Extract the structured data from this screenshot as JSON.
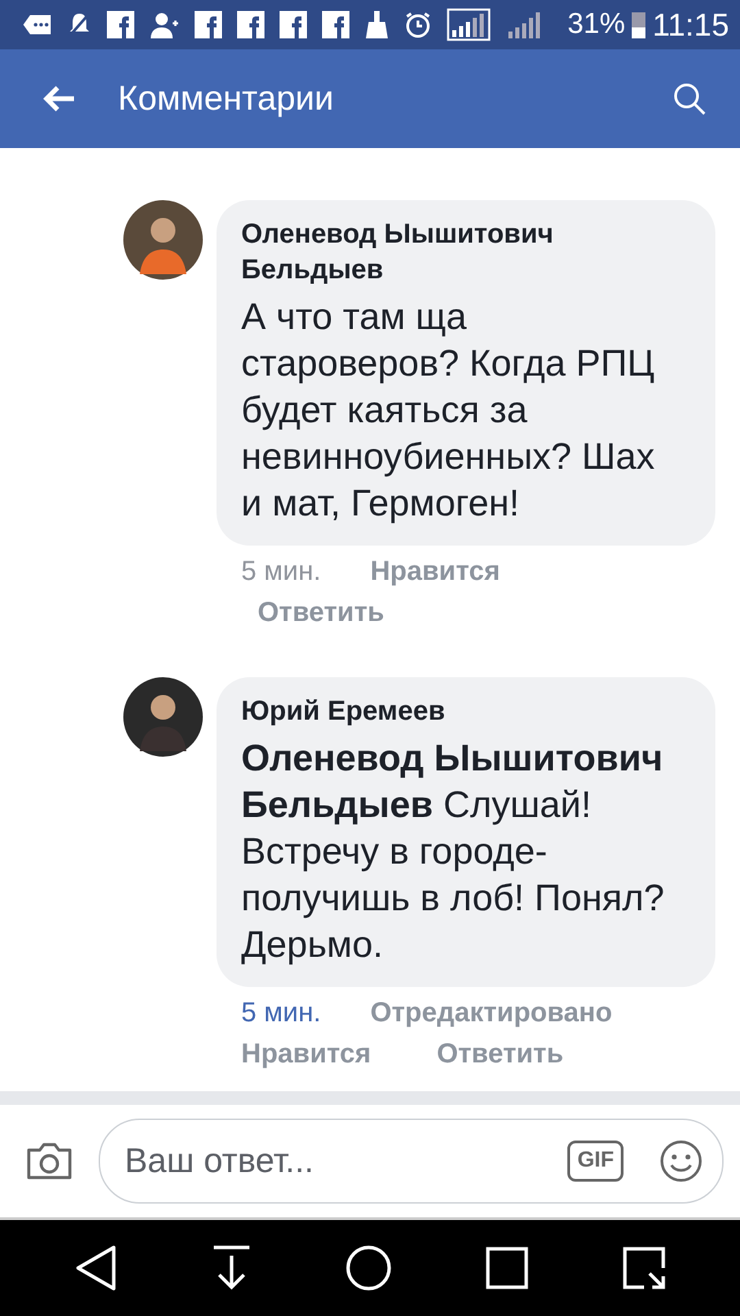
{
  "status_bar": {
    "battery": "31%",
    "time": "11:15"
  },
  "header": {
    "title": "Комментарии"
  },
  "comments": [
    {
      "author": "Оленевод Ыышитович Бельдыев",
      "text": "А что там ща староверов? Когда РПЦ будет каяться за невинноубиенных? Шах и мат, Гермоген!",
      "time": "5 мин.",
      "time_highlighted": false,
      "actions": [
        "Нравится",
        "Ответить"
      ]
    },
    {
      "author": "Юрий Еремеев",
      "text": "**Оленевод Ыышитович Бельдыев** Слушай! Встречу в городе-получишь в лоб! Понял? Дерьмо.",
      "time": "5 мин.",
      "time_highlighted": true,
      "edited": "Отредактировано",
      "actions": [
        "Нравится",
        "Ответить"
      ]
    }
  ],
  "composer": {
    "placeholder": "Ваш ответ...",
    "gif": "GIF"
  }
}
